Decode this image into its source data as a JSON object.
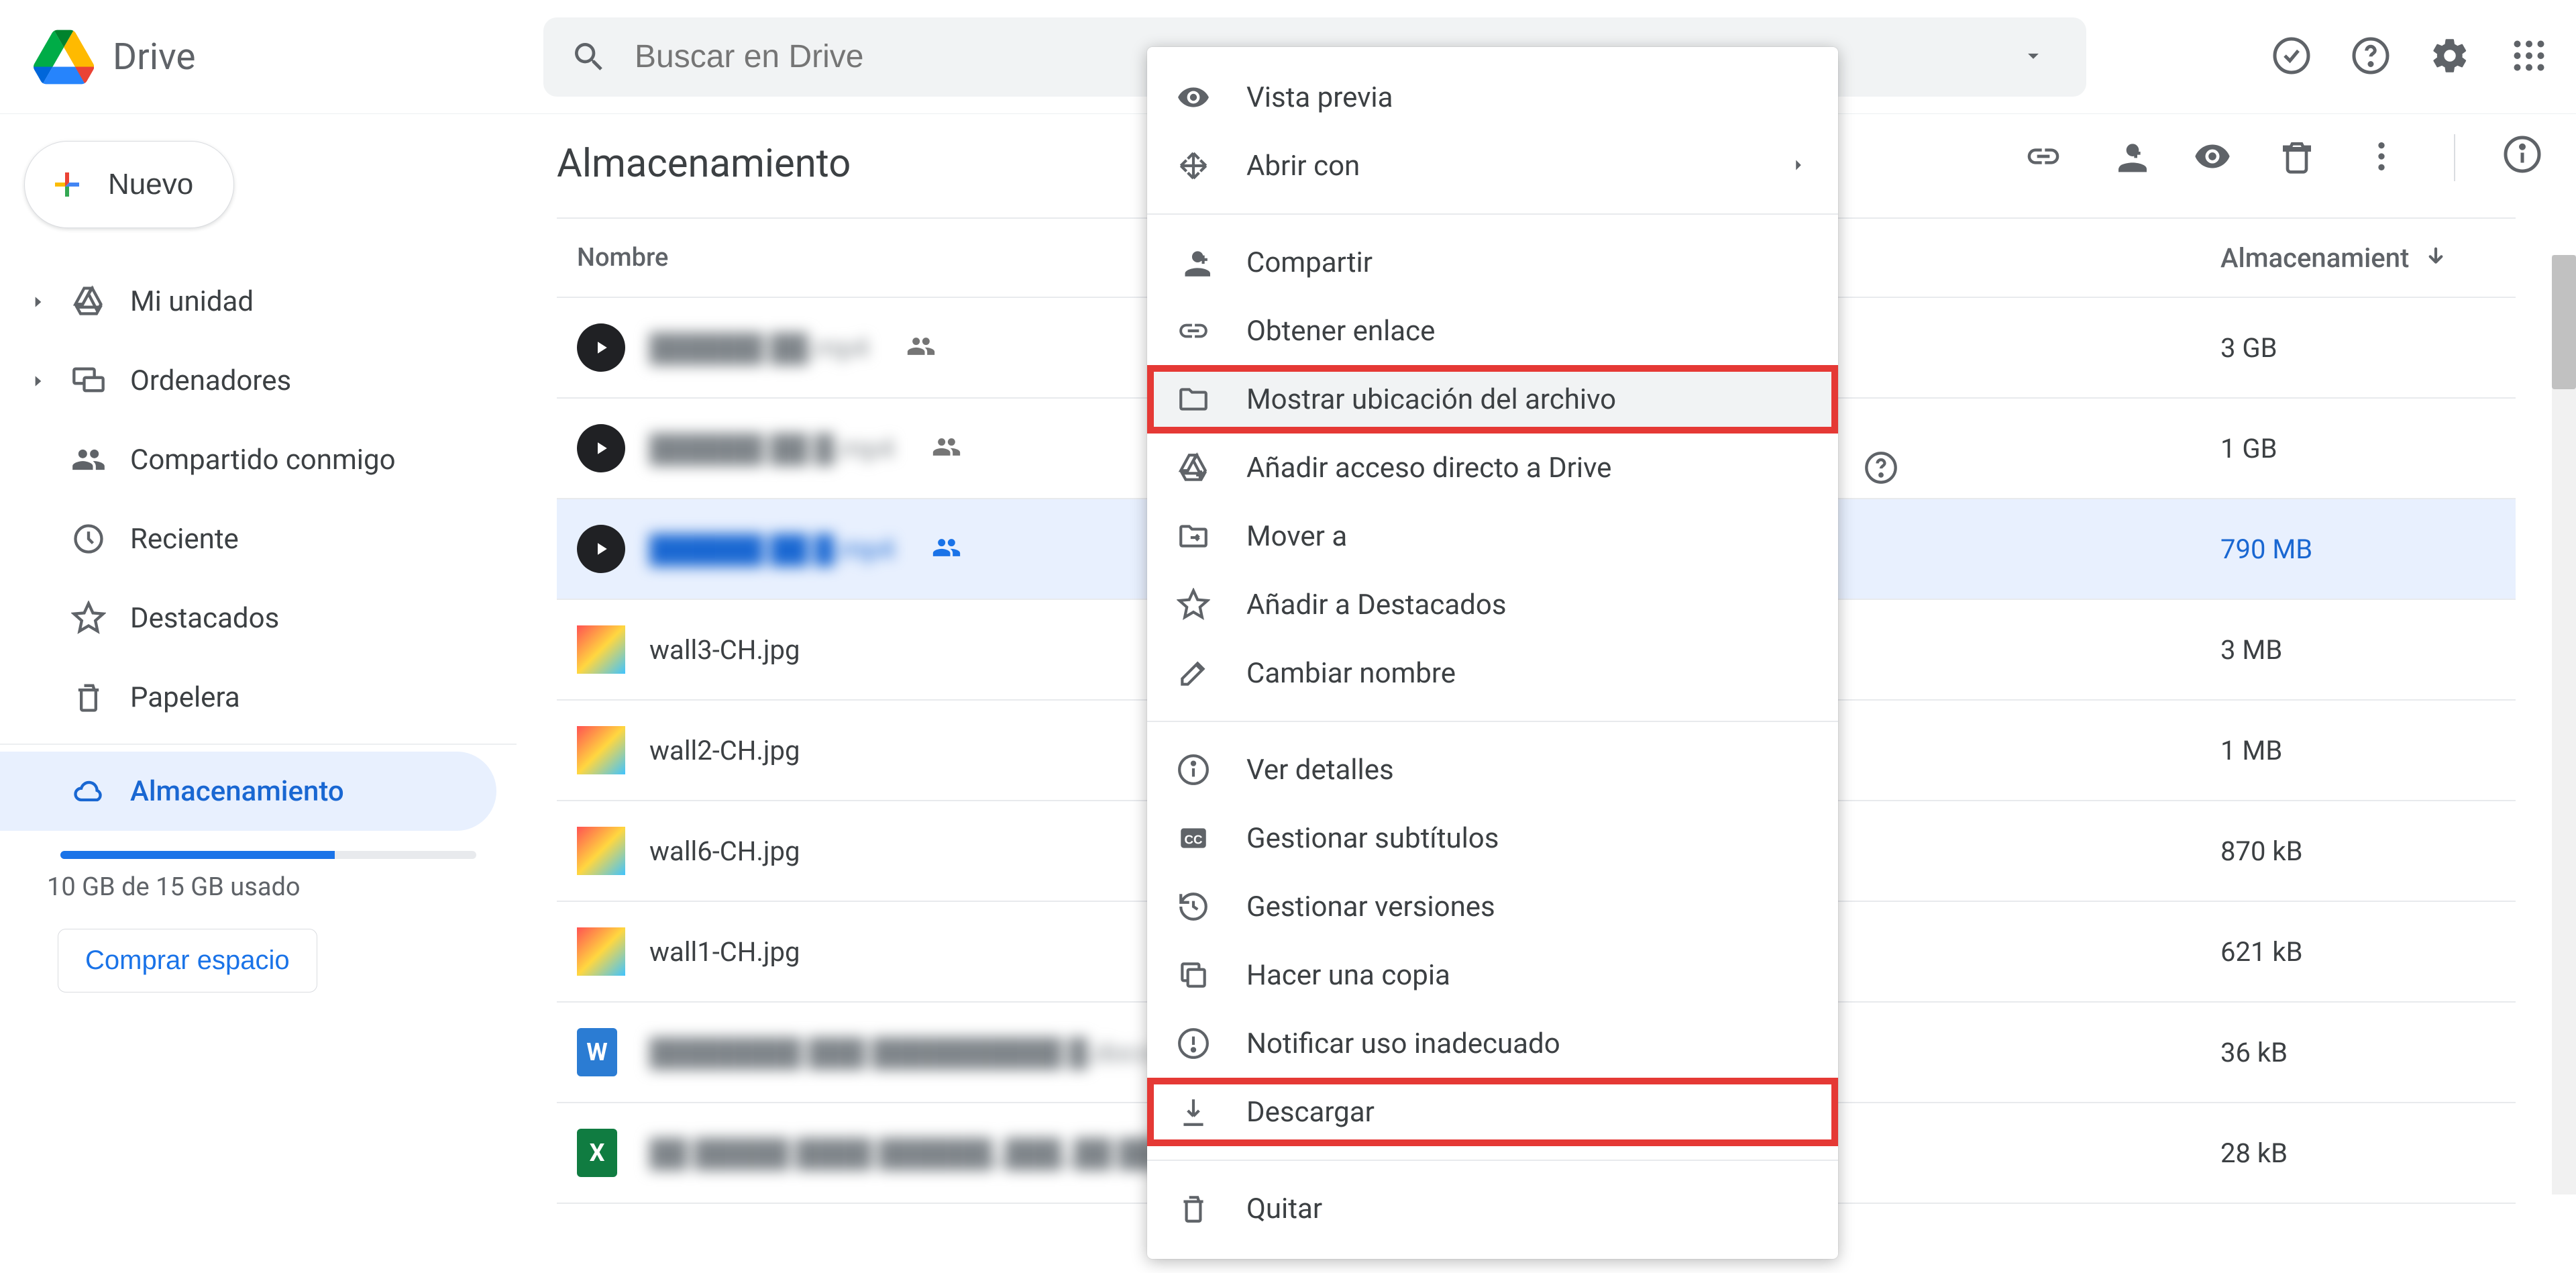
{
  "app": {
    "name": "Drive"
  },
  "search": {
    "placeholder": "Buscar en Drive"
  },
  "new_button": "Nuevo",
  "sidebar": {
    "items": [
      {
        "label": "Mi unidad",
        "icon": "drive"
      },
      {
        "label": "Ordenadores",
        "icon": "computers"
      },
      {
        "label": "Compartido conmigo",
        "icon": "shared"
      },
      {
        "label": "Reciente",
        "icon": "recent"
      },
      {
        "label": "Destacados",
        "icon": "star"
      },
      {
        "label": "Papelera",
        "icon": "trash"
      },
      {
        "label": "Almacenamiento",
        "icon": "cloud"
      }
    ],
    "storage_text": "10 GB de 15 GB usado",
    "buy_button": "Comprar espacio"
  },
  "page": {
    "title": "Almacenamiento",
    "columns": {
      "name_label": "Nombre",
      "size_label": "Almacenamient"
    },
    "files": [
      {
        "name": "██████ ██.mp4",
        "size": "3 GB",
        "type": "video",
        "shared": true,
        "blurred": true
      },
      {
        "name": "██████ ██ █.mp4",
        "size": "1 GB",
        "type": "video",
        "shared": true,
        "blurred": true
      },
      {
        "name": "██████ ██ █.mp4",
        "size": "790 MB",
        "type": "video",
        "shared": true,
        "blurred": true,
        "selected": true
      },
      {
        "name": "wall3-CH.jpg",
        "size": "3 MB",
        "type": "image"
      },
      {
        "name": "wall2-CH.jpg",
        "size": "1 MB",
        "type": "image"
      },
      {
        "name": "wall6-CH.jpg",
        "size": "870 kB",
        "type": "image"
      },
      {
        "name": "wall1-CH.jpg",
        "size": "621 kB",
        "type": "image"
      },
      {
        "name": "████████ ███ ██████████ █.docx",
        "size": "36 kB",
        "type": "word",
        "blurred": true
      },
      {
        "name": "██ █████ ████ ██████_███_██ ██ █",
        "size": "28 kB",
        "type": "excel",
        "blurred": true
      }
    ]
  },
  "context_menu": {
    "items": [
      {
        "label": "Vista previa",
        "icon": "eye"
      },
      {
        "label": "Abrir con",
        "icon": "open",
        "arrow": true
      },
      {
        "sep": true
      },
      {
        "label": "Compartir",
        "icon": "personadd"
      },
      {
        "label": "Obtener enlace",
        "icon": "link"
      },
      {
        "label": "Mostrar ubicación del archivo",
        "icon": "folder",
        "hover": true,
        "highlight": true
      },
      {
        "label": "Añadir acceso directo a Drive",
        "icon": "driveadd",
        "help": true
      },
      {
        "label": "Mover a",
        "icon": "move"
      },
      {
        "label": "Añadir a Destacados",
        "icon": "star"
      },
      {
        "label": "Cambiar nombre",
        "icon": "rename"
      },
      {
        "sep": true
      },
      {
        "label": "Ver detalles",
        "icon": "info"
      },
      {
        "label": "Gestionar subtítulos",
        "icon": "cc"
      },
      {
        "label": "Gestionar versiones",
        "icon": "versions"
      },
      {
        "label": "Hacer una copia",
        "icon": "copy"
      },
      {
        "label": "Notificar uso inadecuado",
        "icon": "report"
      },
      {
        "label": "Descargar",
        "icon": "download",
        "highlight": true
      },
      {
        "sep": true
      },
      {
        "label": "Quitar",
        "icon": "trash"
      }
    ]
  }
}
